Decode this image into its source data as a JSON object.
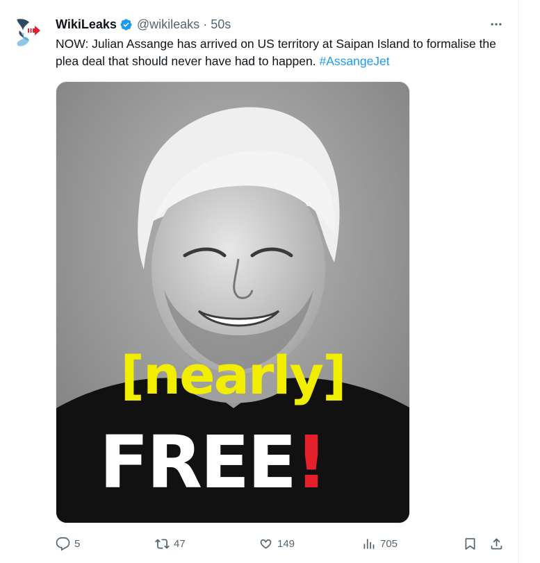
{
  "tweet": {
    "display_name": "WikiLeaks",
    "handle": "@wikileaks",
    "separator": "·",
    "timestamp": "50s",
    "verified": true,
    "text_main": "NOW: Julian Assange has arrived on US territory at Saipan Island to formalise the plea deal that should never have had to happen. ",
    "hashtag": "#AssangeJet"
  },
  "media": {
    "overlay_line1": "[nearly]",
    "overlay_line2": "FREE",
    "overlay_bang": "!"
  },
  "actions": {
    "replies": "5",
    "reposts": "47",
    "likes": "149",
    "views": "705"
  },
  "colors": {
    "accent": "#1d9bf0",
    "secondary_text": "#536471",
    "overlay_yellow": "#f2ee00",
    "overlay_red": "#e4202a"
  },
  "icons": {
    "avatar": "wikileaks-logo-icon",
    "verified": "verified-badge-icon",
    "more": "more-dots-icon",
    "reply": "reply-bubble-icon",
    "repost": "repost-arrows-icon",
    "like": "heart-icon",
    "views": "views-bars-icon",
    "bookmark": "bookmark-icon",
    "share": "share-upload-icon"
  }
}
